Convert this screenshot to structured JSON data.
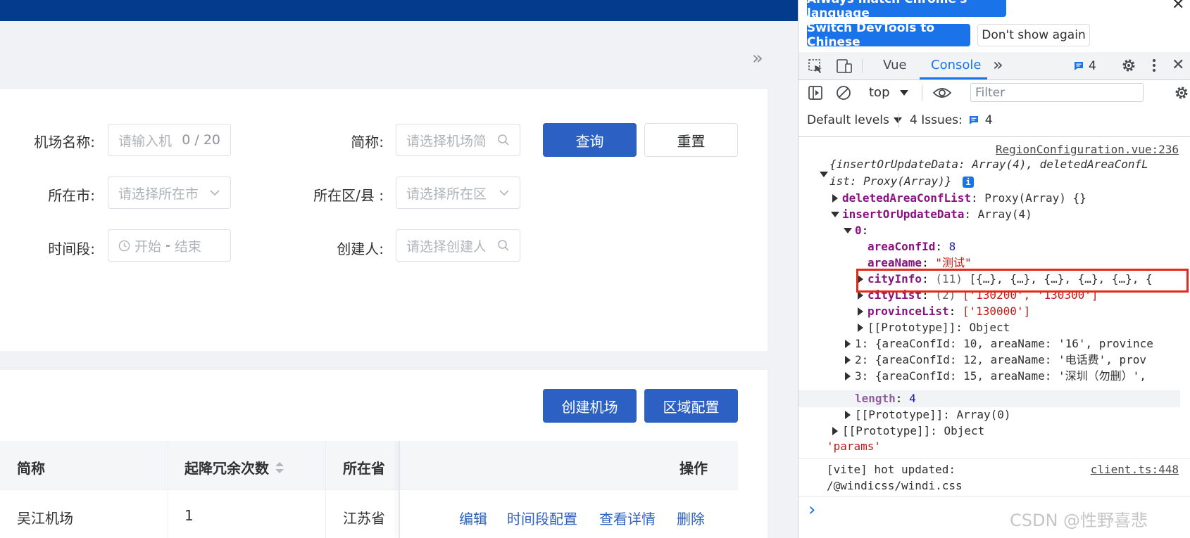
{
  "app": {
    "search": {
      "airport_name_label": "机场名称:",
      "airport_name_placeholder": "请输入机",
      "airport_name_count": "0 / 20",
      "short_name_label": "简称:",
      "short_name_placeholder": "请选择机场简",
      "city_label": "所在市:",
      "city_placeholder": "请选择所在市",
      "district_label": "所在区/县 :",
      "district_placeholder": "请选择所在区",
      "period_label": "时间段:",
      "period_start": "开始",
      "period_sep": "-",
      "period_end": "结束",
      "creator_label": "创建人:",
      "creator_placeholder": "请选择创建人",
      "query_button": "查询",
      "reset_button": "重置"
    },
    "actions": {
      "create_airport": "创建机场",
      "region_config": "区域配置"
    },
    "table": {
      "headers": [
        "简称",
        "起降冗余次数",
        "所在省",
        "操作"
      ],
      "rows": [
        {
          "short_name": "吴江机场",
          "count": "1",
          "province": "江苏省"
        }
      ],
      "row_actions": [
        "编辑",
        "时间段配置",
        "查看详情",
        "删除"
      ]
    }
  },
  "devtools": {
    "banner": {
      "always_match": "Always match Chrome's language",
      "switch_chinese": "Switch DevTools to Chinese",
      "dont_show": "Don't show again"
    },
    "tabs": {
      "vue": "Vue",
      "console": "Console",
      "message_count": "4"
    },
    "toolbar": {
      "context": "top",
      "filter_placeholder": "Filter",
      "default_levels": "Default levels",
      "issues_label": "4 Issues:",
      "issues_count": "4"
    },
    "console": {
      "source1": "RegionConfiguration.vue:236",
      "obj_line1": "{insertOrUpdateData: Array(4), deletedAreaConfL",
      "obj_line2": "ist: Proxy(Array)}",
      "info_badge": "i",
      "deleted_key": "deletedAreaConfList",
      "deleted_val": ": Proxy(Array) {}",
      "insert_key": "insertOrUpdateData",
      "insert_val": ": Array(4)",
      "idx0": "0",
      "colon": ":",
      "areaConfId_key": "areaConfId",
      "areaConfId_val": "8",
      "areaName_key": "areaName",
      "areaName_val": "\"测试\"",
      "cityInfo_key": "cityInfo",
      "cityInfo_count": "(11)",
      "cityInfo_val": "[{…}, {…}, {…}, {…}, {…}, {",
      "cityList_key": "cityList",
      "cityList_count": "(2)",
      "cityList_val": "['130200', '130300']",
      "provinceList_key": "provinceList",
      "provinceList_val": "['130000']",
      "proto_object": "[[Prototype]]: Object",
      "row1": "1: {areaConfId: 10, areaName: '16', province",
      "row2": "2: {areaConfId: 12, areaName: '电话费', prov",
      "row3": "3: {areaConfId: 15, areaName: '深圳（勿删）',",
      "length_key": "length",
      "length_val": "4",
      "proto_array": "[[Prototype]]: Array(0)",
      "proto_object2": "[[Prototype]]: Object",
      "params": "'params'",
      "vite_line1": "[vite] hot updated:",
      "vite_line2": "/@windicss/windi.css",
      "source2": "client.ts:448",
      "prompt": "›"
    },
    "watermark": "CSDN @性野喜悲",
    "highlight_color": "#e8271c"
  }
}
